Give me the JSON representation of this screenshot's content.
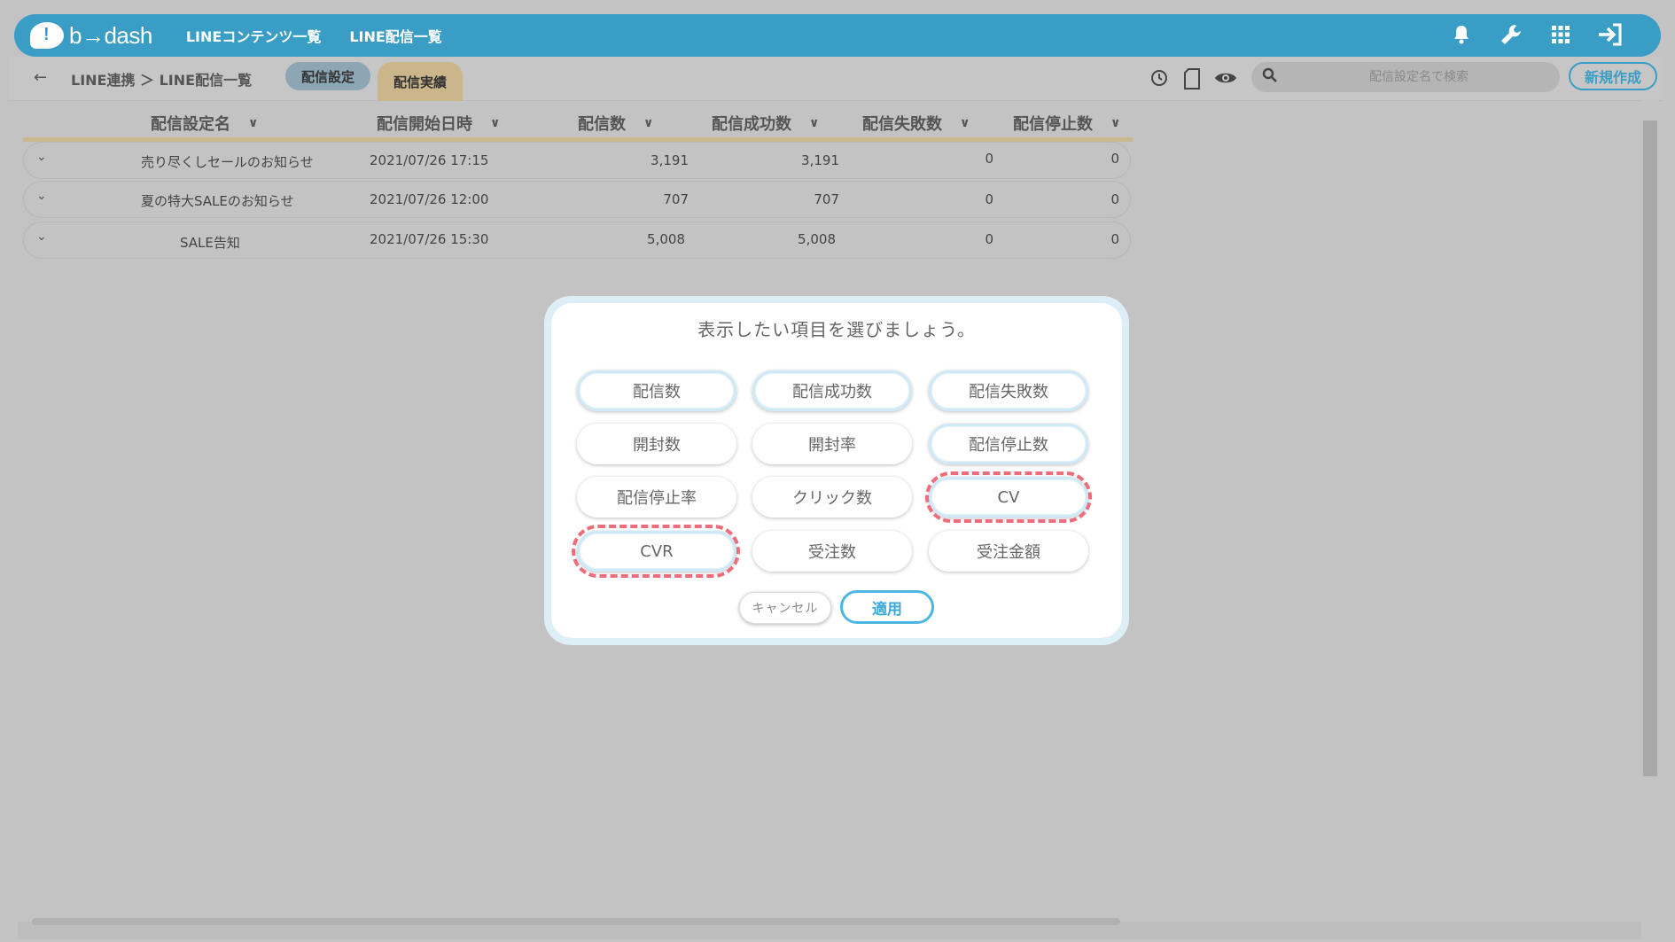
{
  "header": {
    "logo_text": "b→dash",
    "nav": [
      "LINEコンテンツ一覧",
      "LINE配信一覧"
    ],
    "icons": [
      "bell-icon",
      "wrench-icon",
      "grid-icon",
      "logout-icon"
    ]
  },
  "subheader": {
    "breadcrumb": "LINE連携 ＞ LINE配信一覧",
    "tabs": [
      "配信設定",
      "配信実績"
    ],
    "active_tab": "配信実績",
    "icons": [
      "history-icon",
      "file-icon",
      "eye-icon"
    ],
    "search_placeholder": "配信設定名で検索",
    "new_button": "新規作成"
  },
  "table": {
    "columns": [
      "配信設定名",
      "配信開始日時",
      "配信数",
      "配信成功数",
      "配信失敗数",
      "配信停止数"
    ],
    "rows": [
      {
        "name": "売り尽くしセールのお知らせ",
        "start": "2021/07/26 17:15",
        "sent": "3,191",
        "success": "3,191",
        "fail": "0",
        "stop": "0"
      },
      {
        "name": "夏の特大SALEのお知らせ",
        "start": "2021/07/26 12:00",
        "sent": "707",
        "success": "707",
        "fail": "0",
        "stop": "0"
      },
      {
        "name": "SALE告知",
        "start": "2021/07/26 15:30",
        "sent": "5,008",
        "success": "5,008",
        "fail": "0",
        "stop": "0"
      }
    ]
  },
  "modal": {
    "title": "表示したい項目を選びましょう。",
    "options": [
      {
        "label": "配信数",
        "selected": true
      },
      {
        "label": "配信成功数",
        "selected": true
      },
      {
        "label": "配信失敗数",
        "selected": true
      },
      {
        "label": "開封数",
        "selected": false
      },
      {
        "label": "開封率",
        "selected": false
      },
      {
        "label": "配信停止数",
        "selected": true
      },
      {
        "label": "配信停止率",
        "selected": false
      },
      {
        "label": "クリック数",
        "selected": false
      },
      {
        "label": "CV",
        "selected": true
      },
      {
        "label": "CVR",
        "selected": true
      },
      {
        "label": "受注数",
        "selected": false
      },
      {
        "label": "受注金額",
        "selected": false
      }
    ],
    "cancel": "キャンセル",
    "apply": "適用"
  },
  "colors": {
    "brand": "#3a9dc5",
    "highlight": "#ef6c7a",
    "tab_active": "#cbb58a"
  }
}
